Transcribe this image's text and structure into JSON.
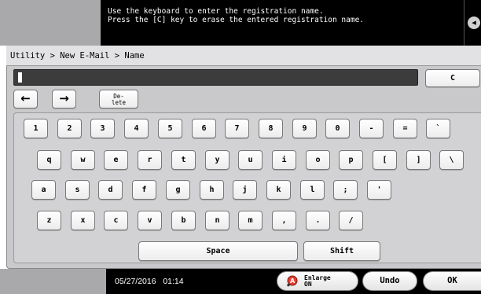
{
  "message": {
    "line1": "Use the keyboard to enter the registration name.",
    "line2": "Press the [C] key to erase the entered registration name."
  },
  "breadcrumb": "Utility > New E-Mail > Name",
  "input": {
    "value": ""
  },
  "controls": {
    "clear_label": "C",
    "left_arrow": "←",
    "right_arrow": "→",
    "delete_line1": "De-",
    "delete_line2": "lete"
  },
  "keyboard": {
    "row1": [
      "1",
      "2",
      "3",
      "4",
      "5",
      "6",
      "7",
      "8",
      "9",
      "0",
      "-",
      "=",
      "`"
    ],
    "row2": [
      "q",
      "w",
      "e",
      "r",
      "t",
      "y",
      "u",
      "i",
      "o",
      "p",
      "[",
      "]",
      "\\"
    ],
    "row3": [
      "a",
      "s",
      "d",
      "f",
      "g",
      "h",
      "j",
      "k",
      "l",
      ";",
      "'"
    ],
    "row4": [
      "z",
      "x",
      "c",
      "v",
      "b",
      "n",
      "m",
      ",",
      ".",
      "/"
    ],
    "space_label": "Space",
    "shift_label": "Shift"
  },
  "footer": {
    "date": "05/27/2016",
    "time": "01:14",
    "enlarge_line1": "Enlarge",
    "enlarge_line2": "ON",
    "undo_label": "Undo",
    "ok_label": "OK"
  }
}
